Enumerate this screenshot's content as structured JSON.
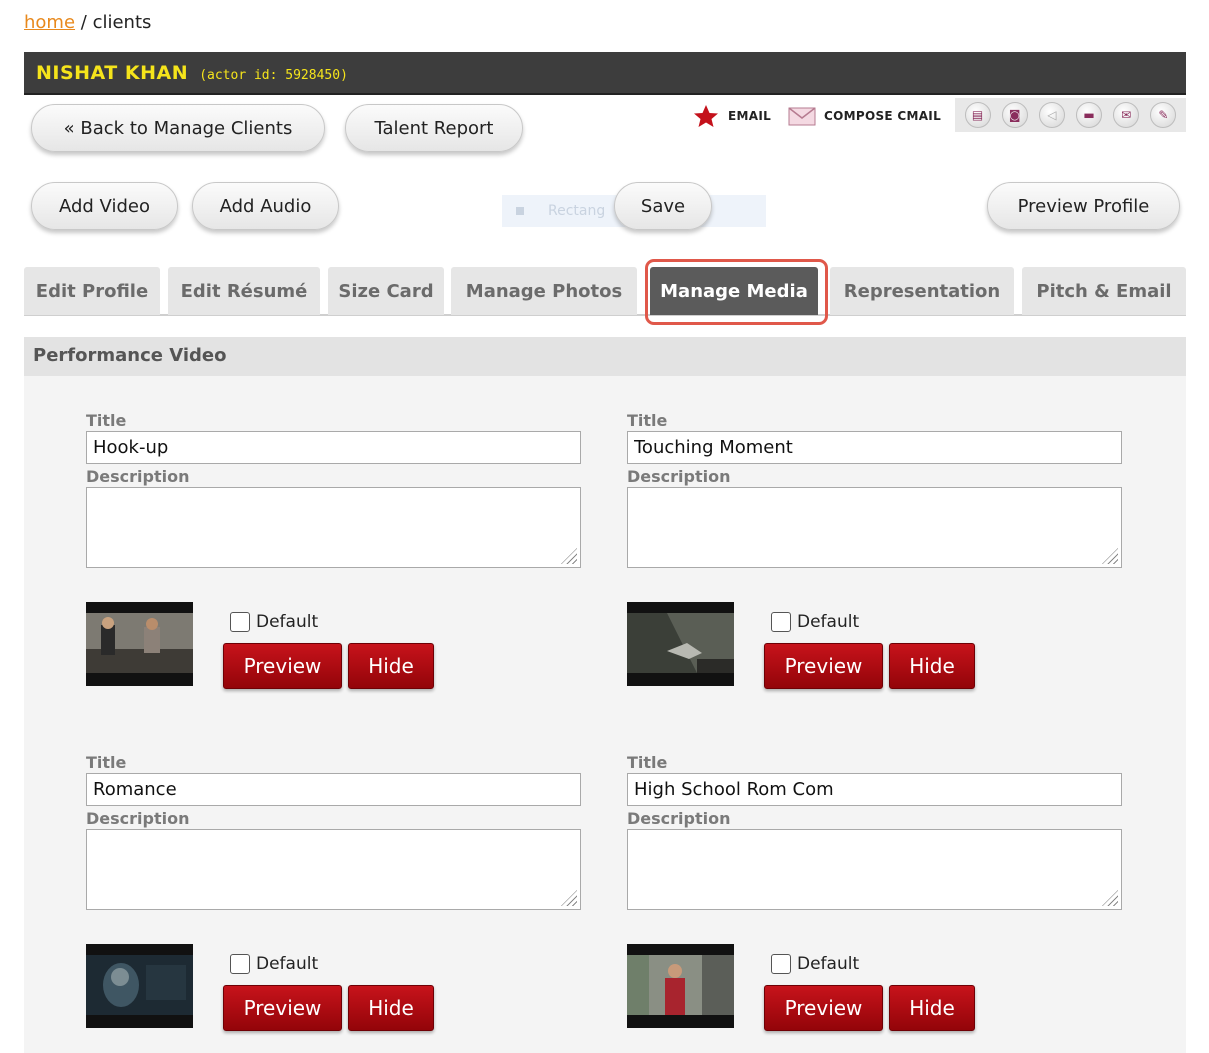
{
  "breadcrumb": {
    "home_label": "home",
    "separator": "/",
    "current": "clients"
  },
  "actor": {
    "name": "NISHAT KHAN",
    "id_text": "(actor id: 5928450)"
  },
  "actions": {
    "back_label": "« Back to Manage Clients",
    "talent_report_label": "Talent Report",
    "add_video_label": "Add Video",
    "add_audio_label": "Add Audio",
    "save_label": "Save",
    "preview_profile_label": "Preview Profile"
  },
  "mail": {
    "email_label": "EMAIL",
    "compose_label": "COMPOSE CMAIL"
  },
  "ghost_label": "Rectang",
  "tabs": [
    {
      "label": "Edit Profile"
    },
    {
      "label": "Edit Résumé"
    },
    {
      "label": "Size Card"
    },
    {
      "label": "Manage Photos"
    },
    {
      "label": "Manage Media"
    },
    {
      "label": "Representation"
    },
    {
      "label": "Pitch & Email"
    }
  ],
  "active_tab": "Manage Media",
  "section": {
    "title": "Performance Video"
  },
  "field_labels": {
    "title": "Title",
    "description": "Description",
    "default": "Default"
  },
  "button_labels": {
    "preview": "Preview",
    "hide": "Hide"
  },
  "videos": [
    {
      "title": "Hook-up",
      "description": "",
      "default": false
    },
    {
      "title": "Touching Moment",
      "description": "",
      "default": false
    },
    {
      "title": "Romance",
      "description": "",
      "default": false
    },
    {
      "title": "High School Rom Com",
      "description": "",
      "default": false
    }
  ],
  "colors": {
    "accent_link": "#e8891d",
    "name_bar": "#3d3d3d",
    "name_text": "#f5e41b",
    "active_tab": "#5b5b5b",
    "tab_highlight": "#e0584a",
    "red_button": "#b30d14"
  }
}
